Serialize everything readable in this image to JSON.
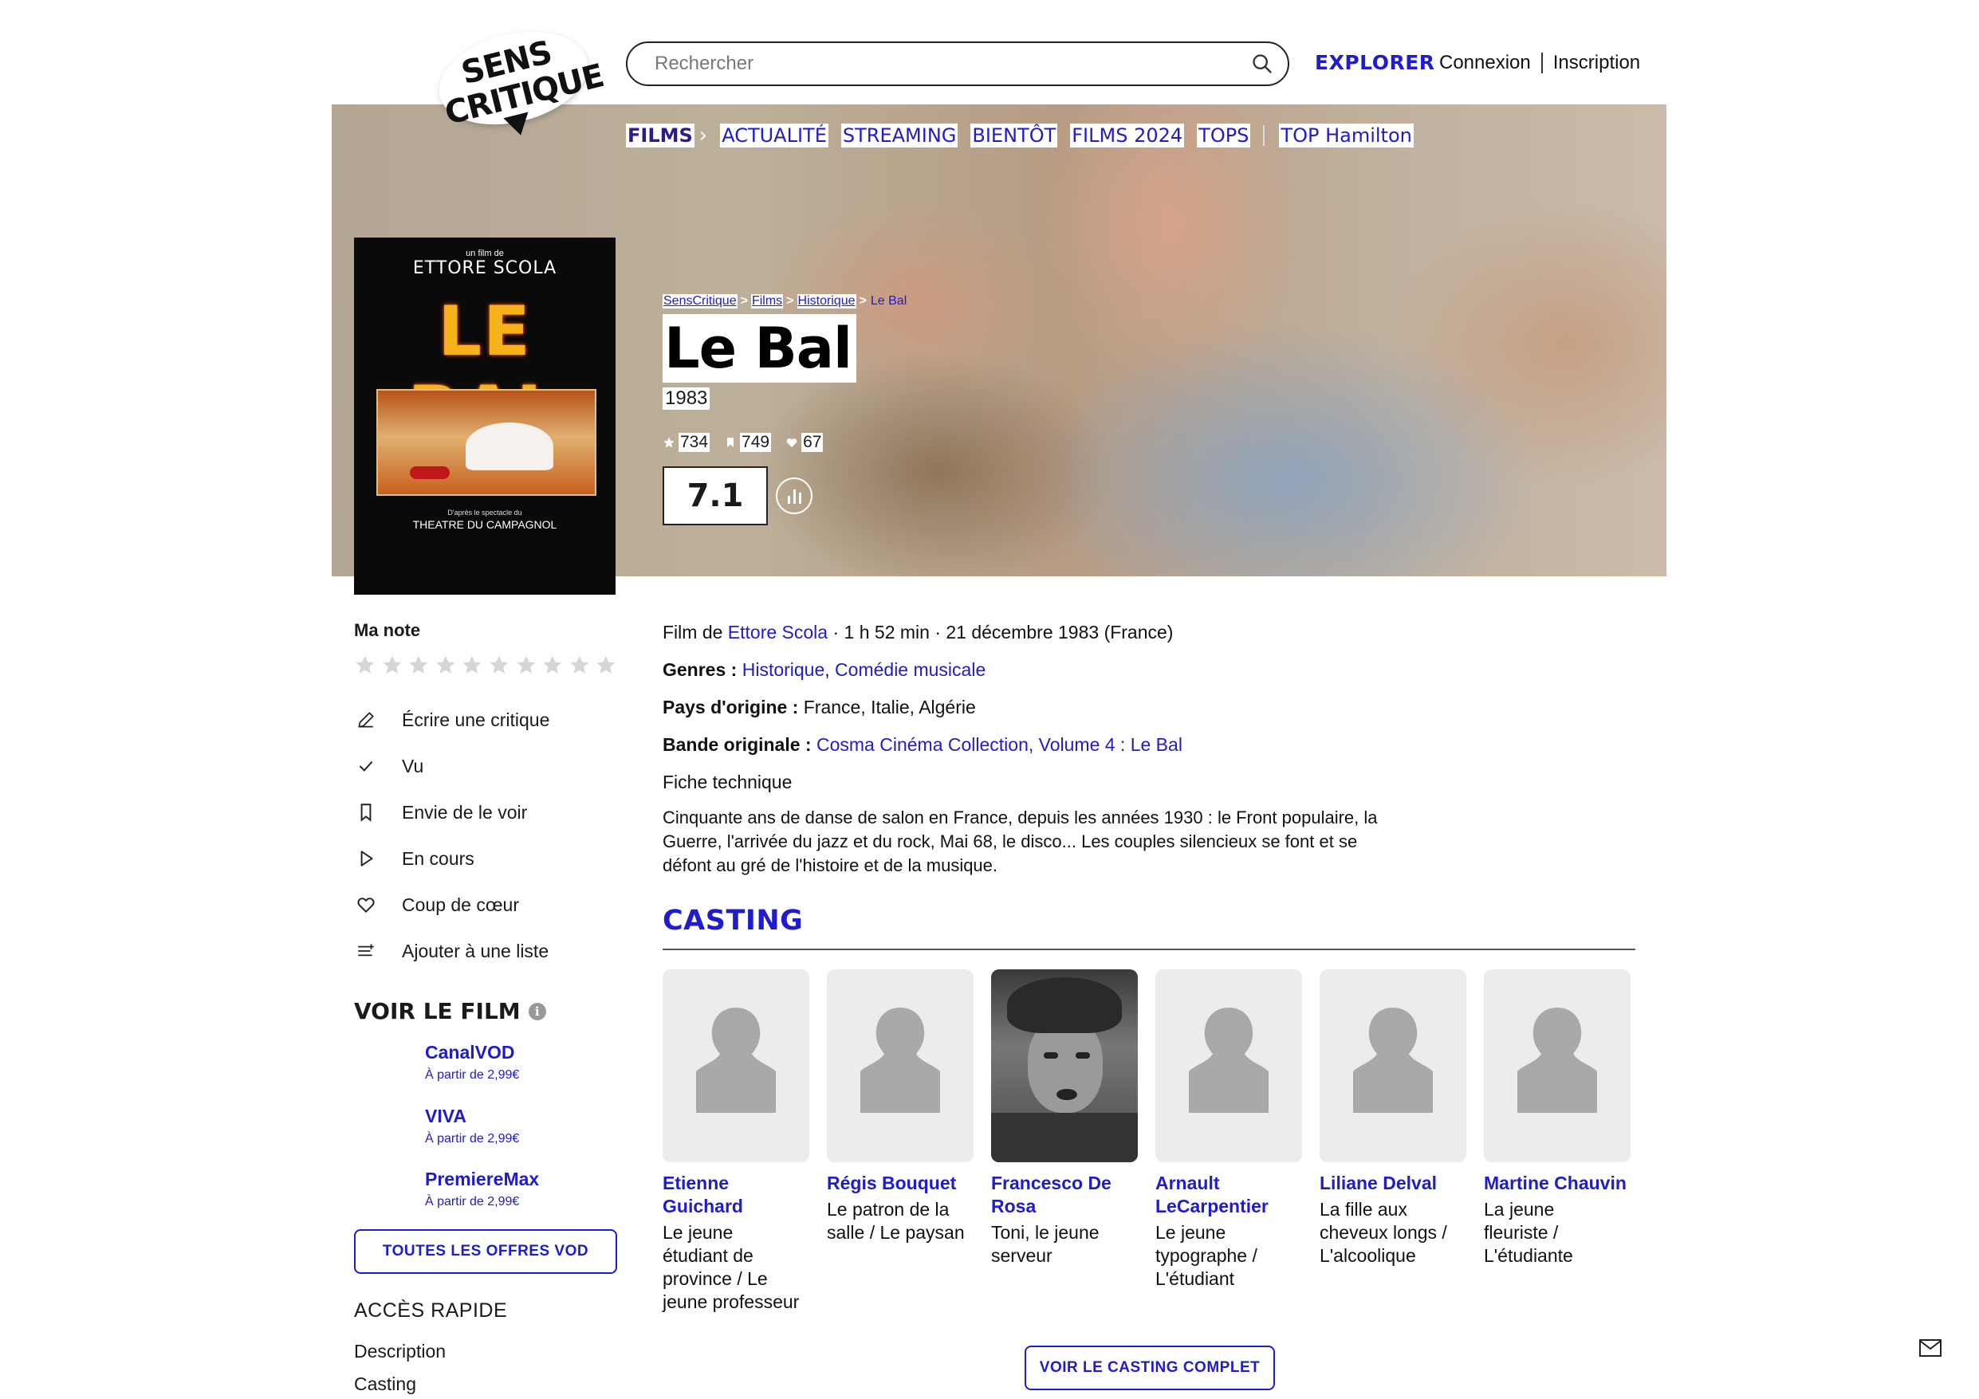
{
  "header": {
    "logo_line1": "SENS",
    "logo_line2": "CRITIQUE",
    "search_placeholder": "Rechercher",
    "explorer": "EXPLORER",
    "login": "Connexion",
    "signup": "Inscription"
  },
  "nav": {
    "films": "FILMS",
    "items": [
      "ACTUALITÉ",
      "STREAMING",
      "BIENTÔT",
      "FILMS 2024",
      "TOPS"
    ],
    "top_hamilton": "TOP Hamilton"
  },
  "poster": {
    "small_top": "un film de",
    "director": "ETTORE SCOLA",
    "title": "LE BAL",
    "subline1": "D'après le spectacle du",
    "subline2": "THEATRE DU CAMPAGNOL"
  },
  "breadcrumb": [
    "SensCritique",
    "Films",
    "Historique",
    "Le Bal"
  ],
  "movie": {
    "title": "Le Bal",
    "year": "1983",
    "stats": {
      "ratings": "734",
      "wishlist": "749",
      "favorites": "67"
    },
    "score": "7.1",
    "line1_prefix": "Film de ",
    "director": "Ettore Scola",
    "line1_suffix": " · 1 h 52 min · 21 décembre 1983 (France)",
    "genres_label": "Genres :",
    "genre1": "Historique",
    "genre_sep": ",",
    "genre2": "Comédie musicale",
    "country_label": "Pays d'origine :",
    "countries": "France, Italie, Algérie",
    "soundtrack_label": "Bande originale :",
    "soundtrack": "Cosma Cinéma Collection, Volume 4 : Le Bal",
    "fiche": "Fiche technique",
    "synopsis": "Cinquante ans de danse de salon en France, depuis les années 1930 : le Front populaire, la Guerre, l'arrivée du jazz et du rock, Mai 68, le disco... Les couples silencieux se font et se défont au gré de l'histoire et de la musique."
  },
  "my_rating": {
    "label": "Ma note",
    "stars": 10
  },
  "actions": [
    {
      "label": "Écrire une critique",
      "icon": "pencil-icon"
    },
    {
      "label": "Vu",
      "icon": "check-icon"
    },
    {
      "label": "Envie de le voir",
      "icon": "bookmark-icon"
    },
    {
      "label": "En cours",
      "icon": "play-icon"
    },
    {
      "label": "Coup de cœur",
      "icon": "heart-icon"
    },
    {
      "label": "Ajouter à une liste",
      "icon": "list-add-icon"
    }
  ],
  "watch": {
    "title": "VOIR LE FILM",
    "offers": [
      {
        "name": "CanalVOD",
        "price": "À partir de 2,99€"
      },
      {
        "name": "VIVA",
        "price": "À partir de 2,99€"
      },
      {
        "name": "PremiereMax",
        "price": "À partir de 2,99€"
      }
    ],
    "all_offers": "TOUTES LES OFFRES VOD"
  },
  "quick_access": {
    "title": "ACCÈS RAPIDE",
    "items": [
      "Description",
      "Casting"
    ]
  },
  "casting": {
    "title": "CASTING",
    "members": [
      {
        "name_l1": "Etienne",
        "name_l2": "Guichard",
        "role": [
          "Le jeune",
          "étudiant de",
          "province / Le",
          "jeune professeur"
        ]
      },
      {
        "name_l1": "Régis Bouquet",
        "name_l2": "",
        "role": [
          "Le patron de la",
          "salle / Le paysan"
        ]
      },
      {
        "name_l1": "Francesco De",
        "name_l2": "Rosa",
        "role": [
          "Toni, le jeune",
          "serveur"
        ]
      },
      {
        "name_l1": "Arnault",
        "name_l2": "LeCarpentier",
        "role": [
          "Le jeune",
          "typographe /",
          "L'étudiant"
        ]
      },
      {
        "name_l1": "Liliane Delval",
        "name_l2": "",
        "role": [
          "La fille aux",
          "cheveux longs /",
          "L'alcoolique"
        ]
      },
      {
        "name_l1": "Martine Chauvin",
        "name_l2": "",
        "role": [
          "La jeune",
          "fleuriste /",
          "L'étudiante"
        ]
      }
    ],
    "full_button": "VOIR LE CASTING COMPLET"
  },
  "colors": {
    "accent": "#1f1bd0",
    "films_nav": "#2b1b8f"
  }
}
